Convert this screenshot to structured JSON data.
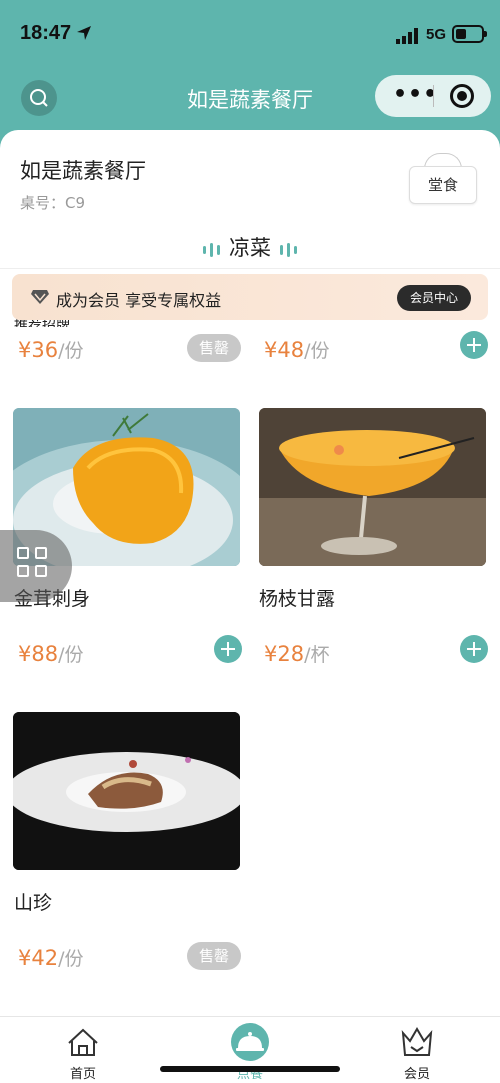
{
  "status_bar": {
    "time": "18:47",
    "network": "5G"
  },
  "nav": {
    "title": "如是蔬素餐厅",
    "more_icon": "more-dots-icon",
    "target_icon": "target-icon",
    "search_icon": "search-icon"
  },
  "shop": {
    "name": "如是蔬素餐厅",
    "table": "桌号：C9",
    "mode": "堂食"
  },
  "section": {
    "title": "凉菜"
  },
  "member_banner": {
    "text": "成为会员 享受专属权益",
    "button": "会员中心"
  },
  "partial_category": "推荐招牌",
  "items": [
    {
      "price": "¥36",
      "unit": "/份",
      "status": "售罄"
    },
    {
      "price": "¥48",
      "unit": "/份",
      "status": "add"
    },
    {
      "name": "金茸刺身",
      "price": "¥88",
      "unit": "/份",
      "status": "add"
    },
    {
      "name": "杨枝甘露",
      "price": "¥28",
      "unit": "/杯",
      "status": "add"
    },
    {
      "name": "山珍",
      "price": "¥42",
      "unit": "/份",
      "status": "售罄"
    }
  ],
  "tabs": [
    {
      "label": "首页",
      "icon": "home-icon"
    },
    {
      "label": "点餐",
      "icon": "dish-cover-icon"
    },
    {
      "label": "会员",
      "icon": "crown-icon"
    }
  ],
  "colors": {
    "accent": "#5eb5ad",
    "price": "#e8823e",
    "soldout": "#c8c8c8"
  }
}
